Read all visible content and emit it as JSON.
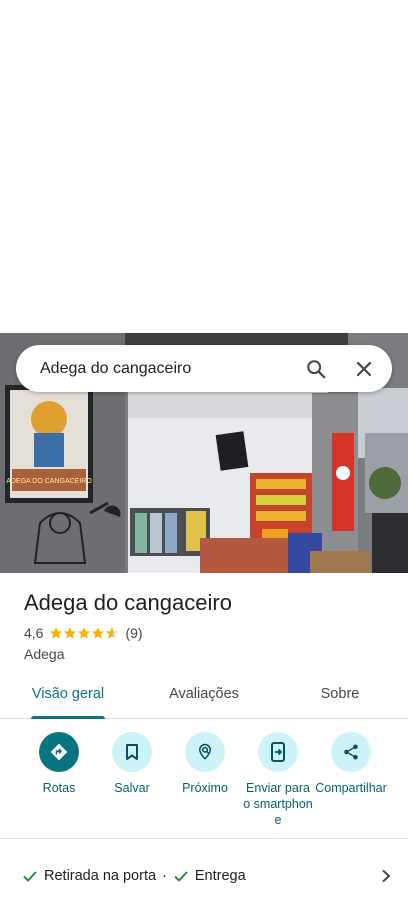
{
  "search": {
    "query": "Adega do cangaceiro"
  },
  "place": {
    "name": "Adega do cangaceiro",
    "rating": "4,6",
    "stars": 4.6,
    "review_count": "(9)",
    "category": "Adega",
    "sign_text": "ADEGA DO CANGACEIRO"
  },
  "tabs": [
    {
      "label": "Visão geral",
      "active": true
    },
    {
      "label": "Avaliações",
      "active": false
    },
    {
      "label": "Sobre",
      "active": false
    }
  ],
  "actions": [
    {
      "label": "Rotas",
      "icon": "directions-icon"
    },
    {
      "label": "Salvar",
      "icon": "bookmark-icon"
    },
    {
      "label": "Próximo",
      "icon": "nearby-icon"
    },
    {
      "label": "Enviar para o smartphone",
      "icon": "send-to-phone-icon"
    },
    {
      "label": "Compartilhar",
      "icon": "share-icon"
    }
  ],
  "services": [
    {
      "label": "Retirada na porta"
    },
    {
      "label": "Entrega"
    }
  ],
  "colors": {
    "accent": "#08747f",
    "action_bg": "#cdf3f9",
    "star": "#f6b400",
    "check": "#1e8e3e"
  }
}
